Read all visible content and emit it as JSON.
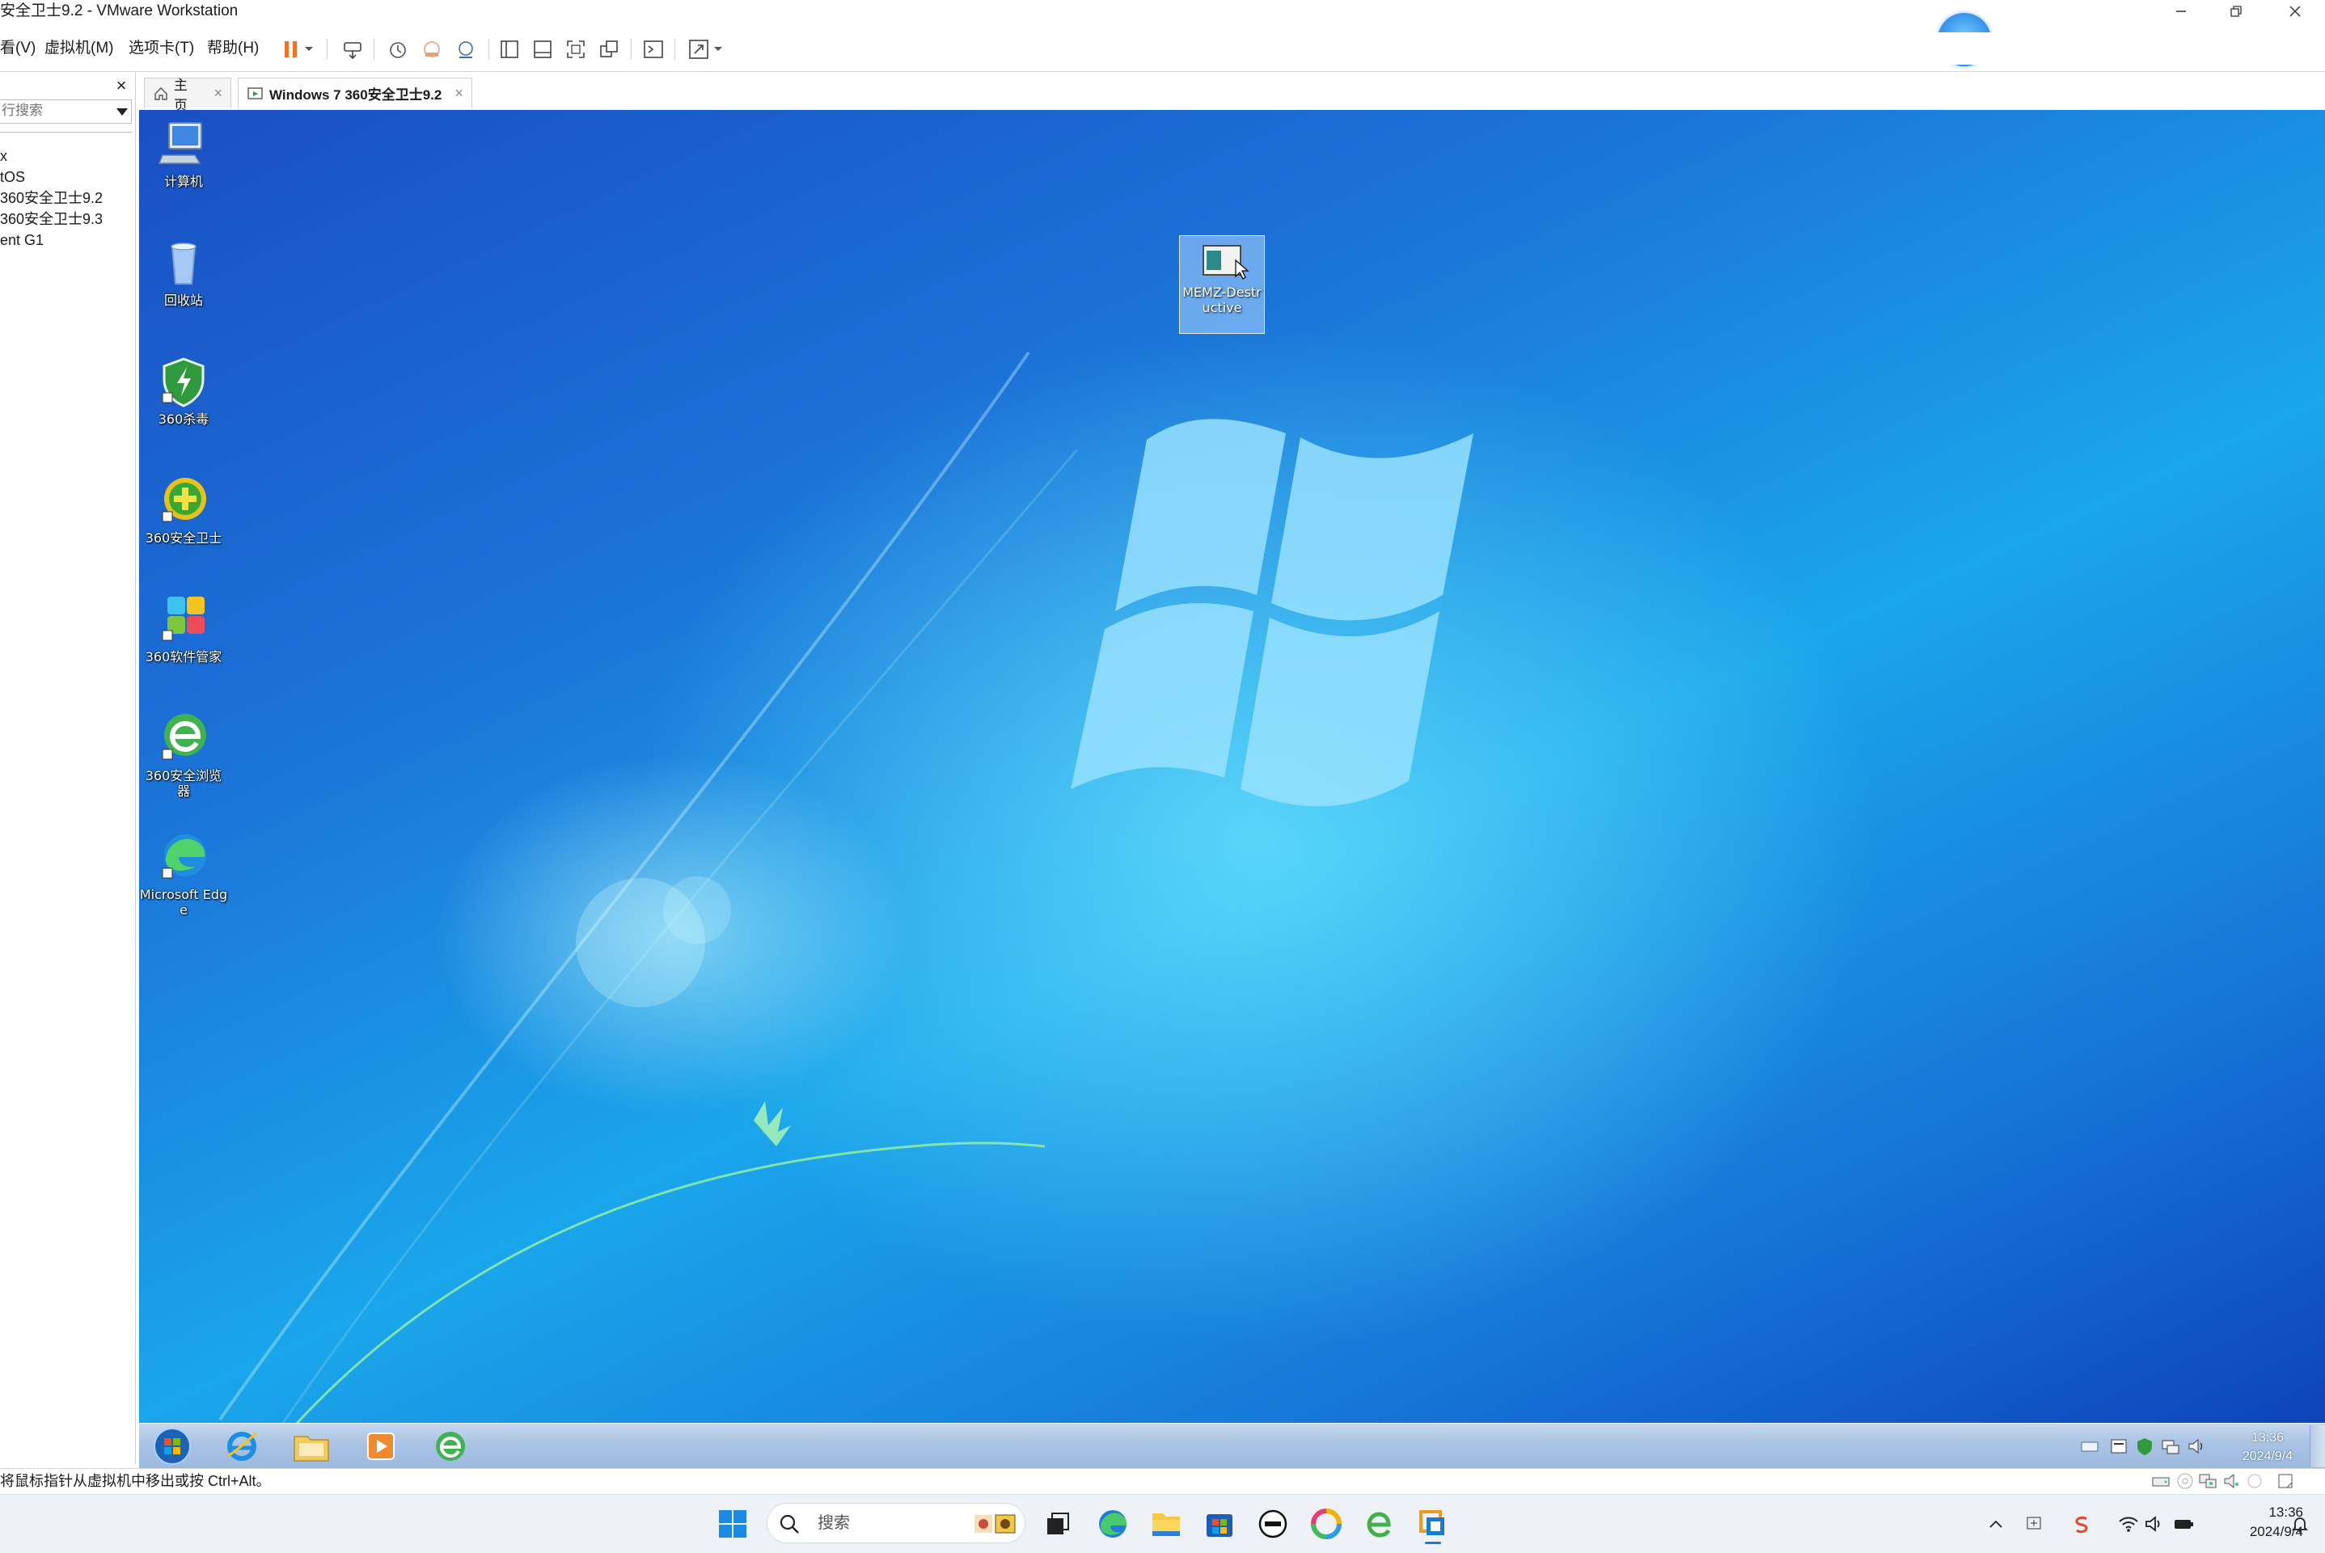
{
  "window": {
    "title": "安全卫士9.2 - VMware Workstation",
    "controls": [
      "minimize",
      "restore",
      "close"
    ]
  },
  "menubar": {
    "items": [
      {
        "id": "view",
        "label": "看(V)"
      },
      {
        "id": "vm",
        "label": "虚拟机(M)"
      },
      {
        "id": "tabs",
        "label": "选项卡(T)"
      },
      {
        "id": "help",
        "label": "帮助(H)"
      }
    ]
  },
  "toolbar": {
    "icons": [
      "pause-icon",
      "dropdown-icon",
      "send-keys-icon",
      "snapshot-icon",
      "revert-snapshot-icon",
      "snapshot-manager-icon",
      "library-view-icon",
      "thumbnail-bar-icon",
      "fullscreen-icon",
      "unity-icon",
      "console-icon",
      "stretch-icon",
      "stretch-dropdown-icon"
    ],
    "accent": "#f0732a"
  },
  "sidebar": {
    "close_glyph": "×",
    "search_placeholder": "行搜索",
    "tree": [
      {
        "label": "x"
      },
      {
        "label": "tOS"
      },
      {
        "label": "360安全卫士9.2"
      },
      {
        "label": "360安全卫士9.3"
      },
      {
        "label": "ent G1"
      }
    ]
  },
  "tabs": [
    {
      "id": "home",
      "label": "主页",
      "icon": "home-icon",
      "active": false
    },
    {
      "id": "vm",
      "label": "Windows 7 360安全卫士9.2",
      "icon": "vm-tab-icon",
      "active": true
    }
  ],
  "guest": {
    "desktop_icons": [
      {
        "id": "computer",
        "label": "计算机",
        "icon": "computer-icon"
      },
      {
        "id": "recycle",
        "label": "回收站",
        "icon": "recycle-bin-icon"
      },
      {
        "id": "360av",
        "label": "360杀毒",
        "icon": "360-antivirus-icon"
      },
      {
        "id": "360safe",
        "label": "360安全卫士",
        "icon": "360-safe-guard-icon"
      },
      {
        "id": "360soft",
        "label": "360软件管家",
        "icon": "360-software-manager-icon"
      },
      {
        "id": "360browser",
        "label": "360安全浏览器",
        "icon": "360-browser-icon"
      },
      {
        "id": "edge",
        "label": "Microsoft Edge",
        "icon": "edge-icon"
      }
    ],
    "selected_file": {
      "label": "MEMZ-Destructive",
      "icon": "exe-file-icon"
    },
    "taskbar": {
      "buttons": [
        "start-orb-icon",
        "ie-icon",
        "explorer-icon",
        "media-player-icon",
        "360-browser-icon"
      ],
      "tray": [
        "keyboard-icon",
        "input-method-icon",
        "security-icon",
        "network-icon",
        "volume-icon"
      ],
      "time": "13:36",
      "date": "2024/9/4"
    }
  },
  "statusbar": {
    "text": "将鼠标指针从虚拟机中移出或按 Ctrl+Alt。",
    "device_icons": [
      "hdd-icon",
      "cdrom-icon",
      "network-adapter-icon",
      "sound-icon",
      "usb-icon",
      "message-icon"
    ]
  },
  "host_taskbar": {
    "search_placeholder": "搜索",
    "apps": [
      "start-icon",
      "task-view-icon",
      "edge-icon",
      "file-explorer-icon",
      "store-icon",
      "dell-icon",
      "color-app-icon",
      "360-browser-icon",
      "vmware-icon"
    ],
    "tray": [
      "chevron-up-icon",
      "ime-icon",
      "sogou-icon",
      "wifi-icon",
      "speaker-icon",
      "battery-icon"
    ],
    "time": "13:36",
    "date": "2024/9/4"
  }
}
